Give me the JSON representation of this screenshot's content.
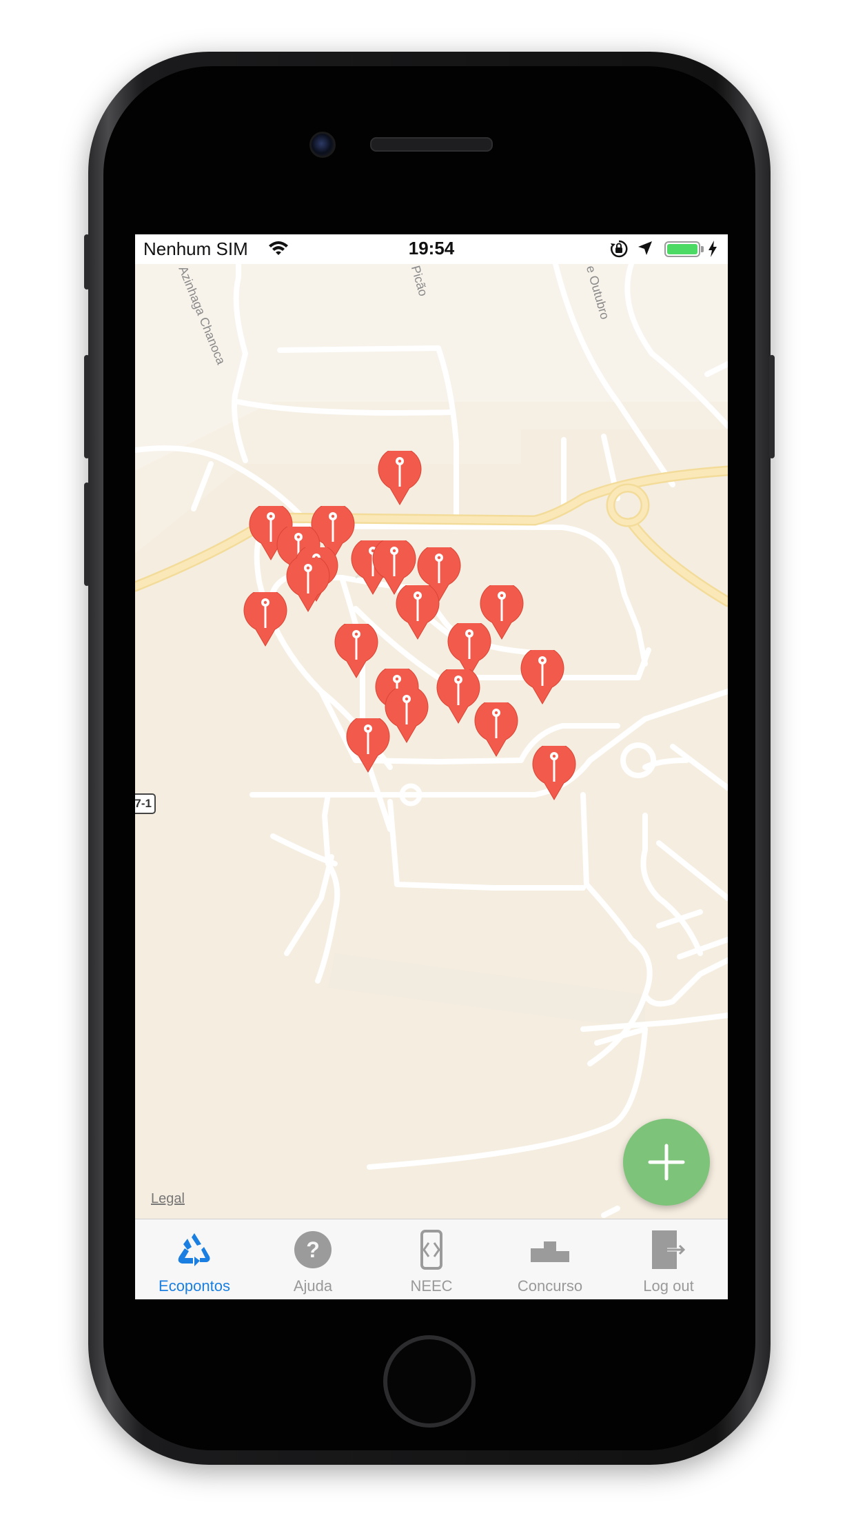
{
  "status_bar": {
    "carrier": "Nenhum SIM",
    "time": "19:54",
    "battery_level": 1.0,
    "icons": [
      "wifi-icon",
      "rotation-lock-icon",
      "location-arrow-icon",
      "battery-icon",
      "charging-bolt-icon"
    ]
  },
  "map": {
    "street_labels": [
      "Azinhaga Chanoca",
      "Picão",
      "e Outubro"
    ],
    "route_badge": "7-1",
    "legal_link": "Legal",
    "pin_count": 22,
    "colors": {
      "pin": "#f25a4b",
      "road": "#ffffff",
      "highway": "#fbe7b5",
      "ground": "#f6efe4"
    }
  },
  "fab": {
    "icon": "plus-icon",
    "color": "#7dc37a"
  },
  "tabs": [
    {
      "label": "Ecopontos",
      "icon": "recycle-icon",
      "active": true
    },
    {
      "label": "Ajuda",
      "icon": "help-icon",
      "active": false
    },
    {
      "label": "NEEC",
      "icon": "phone-code-icon",
      "active": false
    },
    {
      "label": "Concurso",
      "icon": "podium-icon",
      "active": false
    },
    {
      "label": "Log out",
      "icon": "logout-icon",
      "active": false
    }
  ],
  "colors": {
    "active_tab": "#1a7fe0",
    "inactive_tab": "#999999"
  }
}
